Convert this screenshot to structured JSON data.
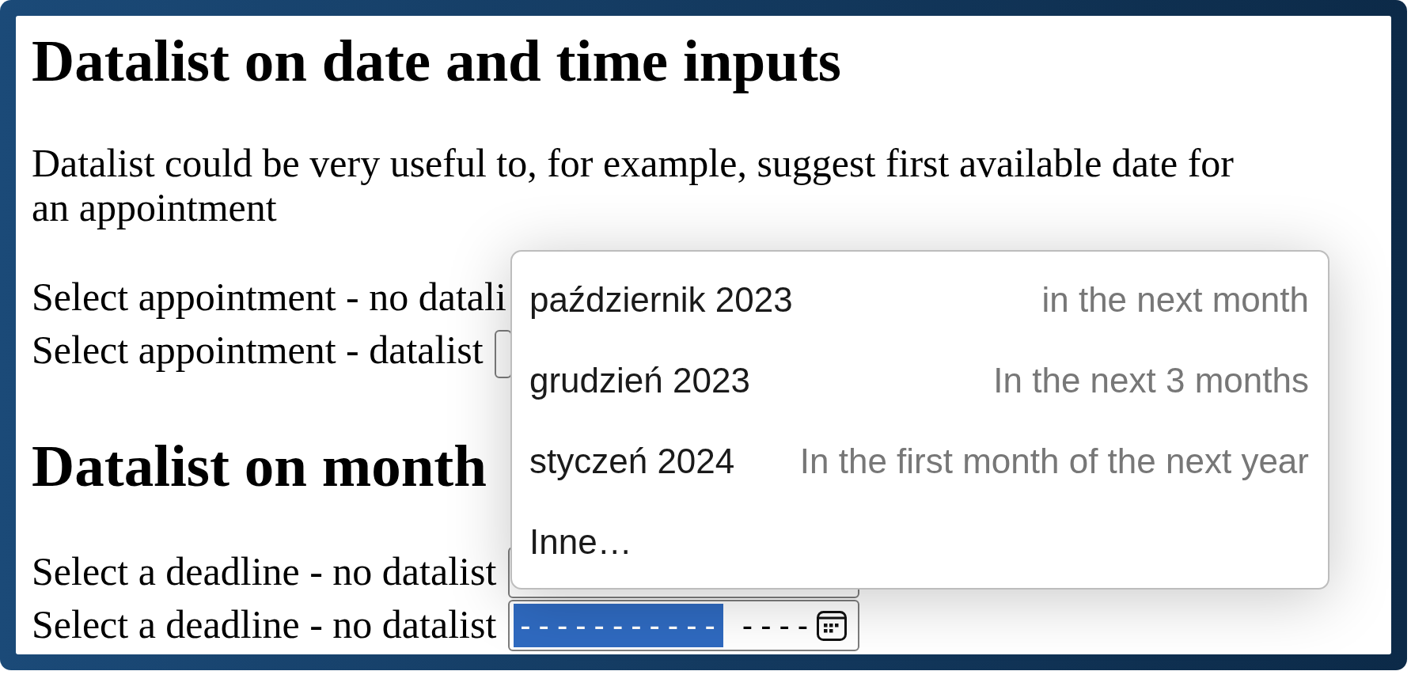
{
  "sections": [
    {
      "heading": "Datalist on date and time inputs",
      "paragraph": "Datalist could be very useful to, for example, suggest first available date for an appointment",
      "fields": [
        {
          "label": "Select appointment - no datali",
          "kind": "covered"
        },
        {
          "label": "Select appointment - datalist",
          "kind": "date"
        }
      ]
    },
    {
      "heading": "Datalist on month",
      "fields": [
        {
          "label": "Select a deadline - no datalist",
          "kind": "month"
        },
        {
          "label": "Select a deadline - no datalist",
          "kind": "month",
          "segments": [
            {
              "text": "-----------",
              "selected": true
            },
            {
              "text": "----",
              "selected": false
            }
          ]
        }
      ]
    }
  ],
  "datalist_popup": {
    "options": [
      {
        "value": "październik 2023",
        "label": "in the next month"
      },
      {
        "value": "grudzień 2023",
        "label": "In the next 3 months"
      },
      {
        "value": "styczeń 2024",
        "label": "In the first month of the next year"
      },
      {
        "value": "Inne…"
      }
    ]
  }
}
